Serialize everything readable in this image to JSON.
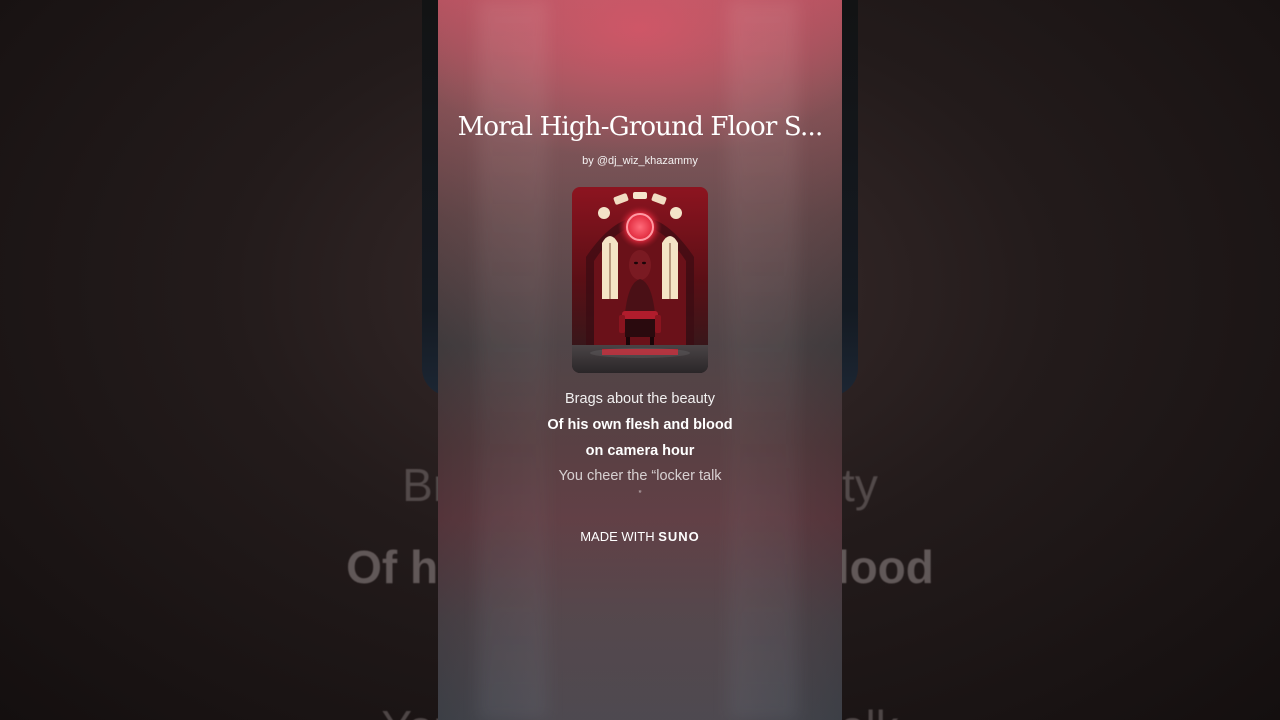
{
  "song": {
    "title": "Moral High-Ground Floor S...",
    "artist": "by @dj_wiz_khazammy"
  },
  "lyrics": [
    "Brags about the beauty",
    "Of his own flesh and blood",
    "on camera hour",
    "You cheer the “locker talk",
    "”"
  ],
  "background_lyrics": [
    "Brags about the beauty",
    "Of his own flesh and blood",
    "You cheer the “locker talk"
  ],
  "footer": {
    "made_with": "MADE WITH",
    "brand": "SUNO"
  },
  "cover_art": {
    "icon": "throne-cathedral-artwork"
  },
  "colors": {
    "accent": "#c43a4e",
    "backdrop": "#1a1414"
  }
}
